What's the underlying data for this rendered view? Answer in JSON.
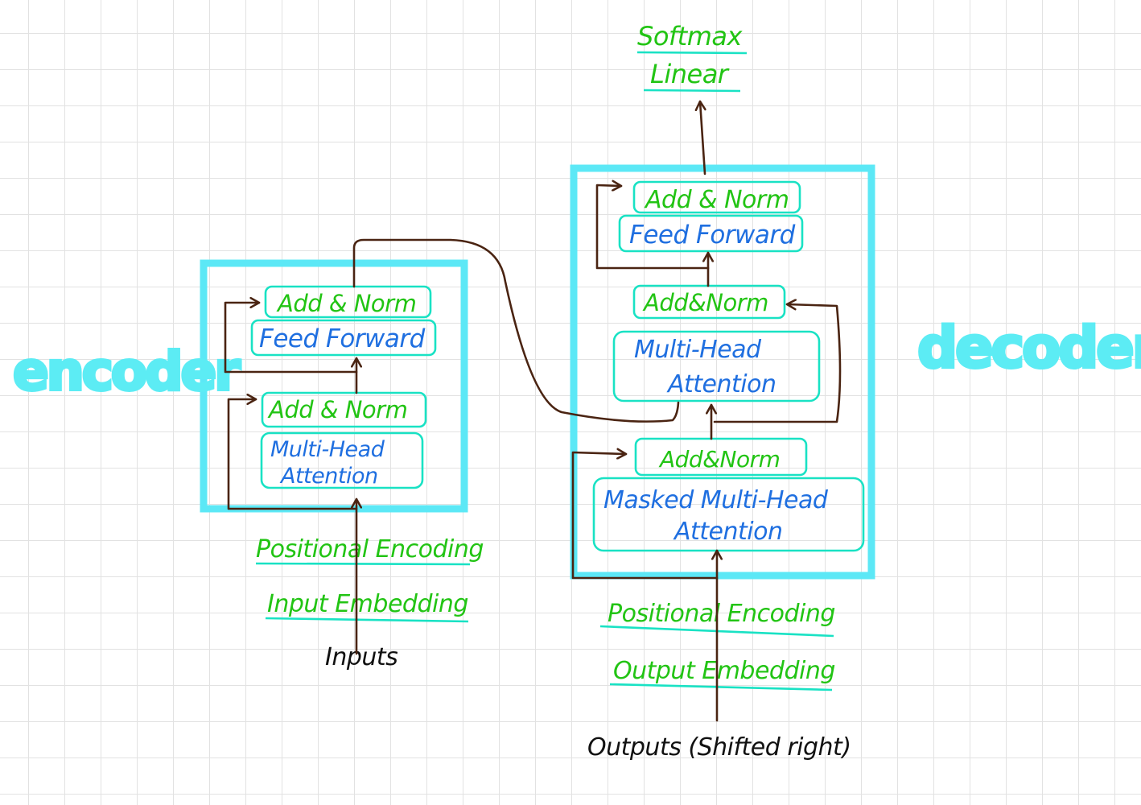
{
  "encoder": {
    "label": "encoder",
    "add_norm_top": "Add & Norm",
    "feed_forward": "Feed Forward",
    "add_norm_bottom": "Add & Norm",
    "mha_line1": "Multi-Head",
    "mha_line2": "Attention",
    "positional_encoding": "Positional Encoding",
    "input_embedding": "Input Embedding",
    "inputs": "Inputs"
  },
  "decoder": {
    "label": "decoder",
    "softmax": "Softmax",
    "linear": "Linear",
    "add_norm_top": "Add & Norm",
    "feed_forward": "Feed Forward",
    "add_norm_mid": "Add&Norm",
    "mha_line1": "Multi-Head",
    "mha_line2": "Attention",
    "add_norm_bottom": "Add&Norm",
    "masked_line1": "Masked Multi-Head",
    "masked_line2": "Attention",
    "positional_encoding": "Positional Encoding",
    "output_embedding": "Output Embedding",
    "outputs": "Outputs (Shifted right)"
  },
  "colors": {
    "block_outline": "#5ce8f6",
    "box_outline": "#19e2c4",
    "norm_text": "#22c414",
    "layer_text": "#1f6fe0",
    "arrow": "#4a2412",
    "side_label": "#5cecf4"
  }
}
